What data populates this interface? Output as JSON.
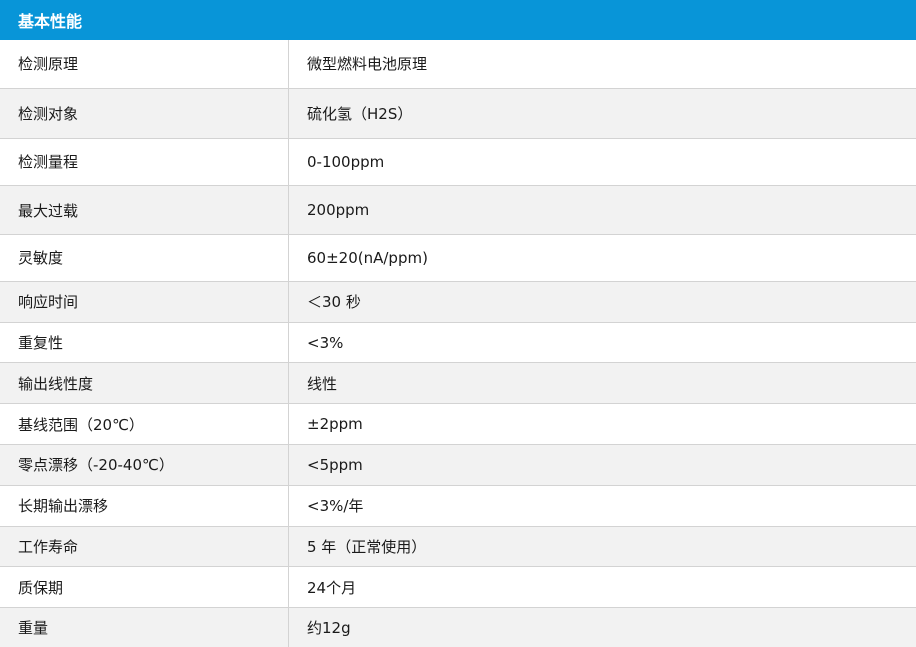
{
  "section": {
    "title": "基本性能"
  },
  "rows": [
    {
      "label": "检测原理",
      "value": "微型燃料电池原理"
    },
    {
      "label": "检测对象",
      "value": "硫化氢（H2S）"
    },
    {
      "label": "检测量程",
      "value": "0-100ppm"
    },
    {
      "label": "最大过载",
      "value": "200ppm"
    },
    {
      "label": "灵敏度",
      "value": "60±20(nA/ppm)"
    },
    {
      "label": "响应时间",
      "value": "＜30 秒"
    },
    {
      "label": "重复性",
      "value": "<3%"
    },
    {
      "label": "输出线性度",
      "value": "线性"
    },
    {
      "label": "基线范围（20℃）",
      "value": "±2ppm"
    },
    {
      "label": "零点漂移（-20-40℃）",
      "value": "<5ppm"
    },
    {
      "label": "长期输出漂移",
      "value": "<3%/年"
    },
    {
      "label": "工作寿命",
      "value": "5 年（正常使用）"
    },
    {
      "label": "质保期",
      "value": "24个月"
    },
    {
      "label": "重量",
      "value": "约12g"
    }
  ]
}
